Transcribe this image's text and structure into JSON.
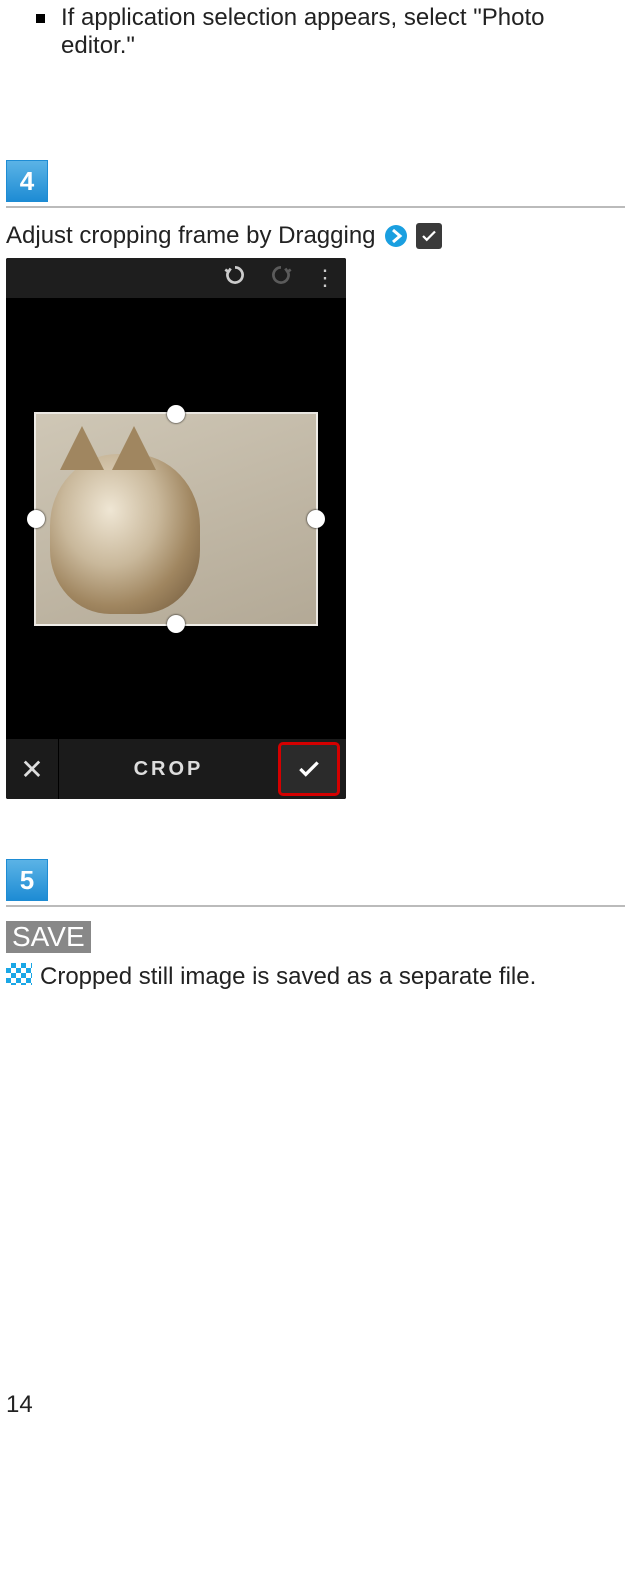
{
  "bullet_note": "If application selection appears, select \"Photo editor.\"",
  "steps": {
    "s4": {
      "number": "4",
      "title": "Adjust cropping frame by Dragging",
      "phone": {
        "crop_label": "CROP"
      }
    },
    "s5": {
      "number": "5",
      "save_label": "SAVE",
      "result_text": "Cropped still image is saved as a separate file."
    }
  },
  "page_number": "14"
}
